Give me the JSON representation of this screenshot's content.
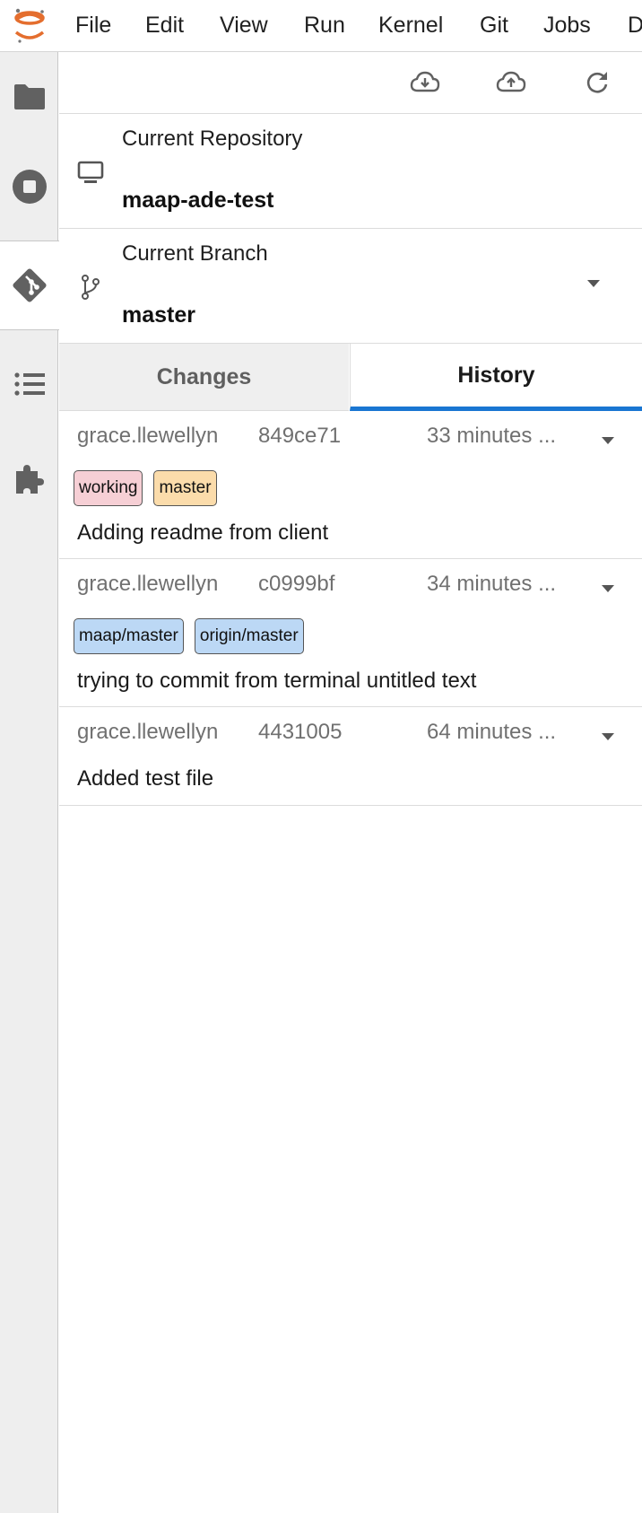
{
  "menu": {
    "items": [
      "File",
      "Edit",
      "View",
      "Run",
      "Kernel",
      "Git",
      "Jobs",
      "D"
    ]
  },
  "sidebar": {
    "icons": [
      "folder-icon",
      "stop-circle-icon",
      "git-icon",
      "list-icon",
      "puzzle-icon"
    ],
    "active": "git-icon"
  },
  "toolbar": {
    "buttons": [
      "pull-icon",
      "push-icon",
      "refresh-icon"
    ]
  },
  "repository": {
    "label": "Current Repository",
    "value": "maap-ade-test"
  },
  "branch": {
    "label": "Current Branch",
    "value": "master"
  },
  "tabs": {
    "changes": "Changes",
    "history": "History",
    "active": "History"
  },
  "commits": [
    {
      "author": "grace.llewellyn",
      "hash": "849ce71",
      "time": "33 minutes ...",
      "tags": [
        "working",
        "master"
      ],
      "message": "Adding readme from client"
    },
    {
      "author": "grace.llewellyn",
      "hash": "c0999bf",
      "time": "34 minutes ...",
      "tags": [
        "maap/master",
        "origin/master"
      ],
      "message": "trying to commit from terminal untitled text"
    },
    {
      "author": "grace.llewellyn",
      "hash": "4431005",
      "time": "64 minutes ...",
      "tags": [],
      "message": "Added test file"
    }
  ],
  "colors": {
    "accent": "#1976d2",
    "logo_orange": "#e46e2e",
    "tag_working": "#f6cfd5",
    "tag_master": "#fbdcab",
    "tag_remote": "#bcd8f5"
  }
}
